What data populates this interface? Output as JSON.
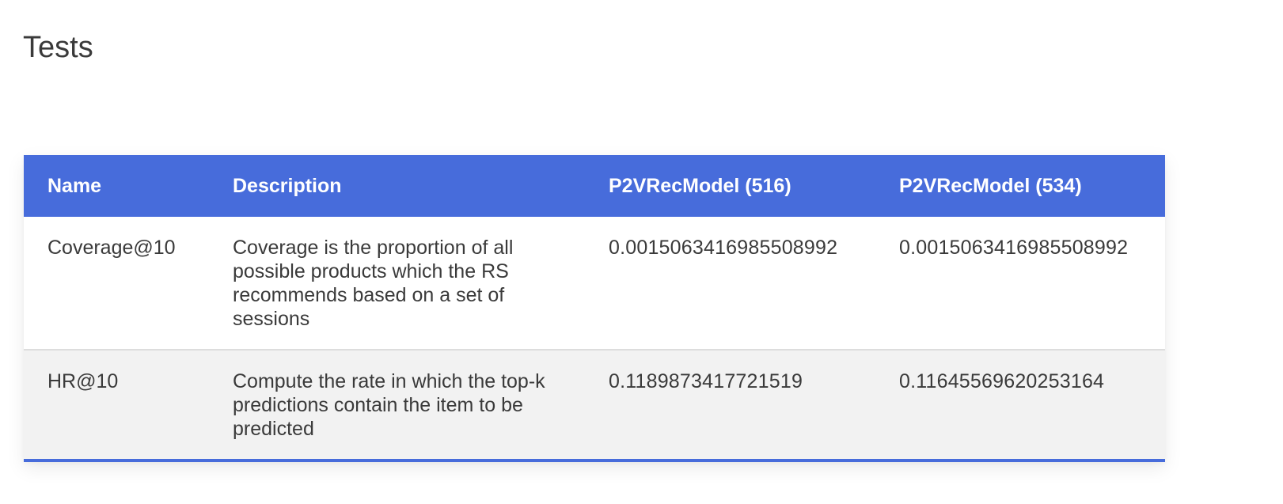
{
  "page": {
    "title": "Tests"
  },
  "table": {
    "headers": [
      "Name",
      "Description",
      "P2VRecModel (516)",
      "P2VRecModel (534)"
    ],
    "rows": [
      {
        "name": "Coverage@10",
        "description": "Coverage is the proportion of all possible products which the RS recommends based on a set of sessions",
        "model_516": "0.0015063416985508992",
        "model_534": "0.0015063416985508992"
      },
      {
        "name": "HR@10",
        "description": "Compute the rate in which the top-k predictions contain the item to be predicted",
        "model_516": "0.1189873417721519",
        "model_534": "0.11645569620253164"
      }
    ]
  },
  "colors": {
    "header_bg": "#476cdb",
    "header_text": "#ffffff",
    "row_alt_bg": "#f2f2f2",
    "text": "#3a3a3a"
  }
}
